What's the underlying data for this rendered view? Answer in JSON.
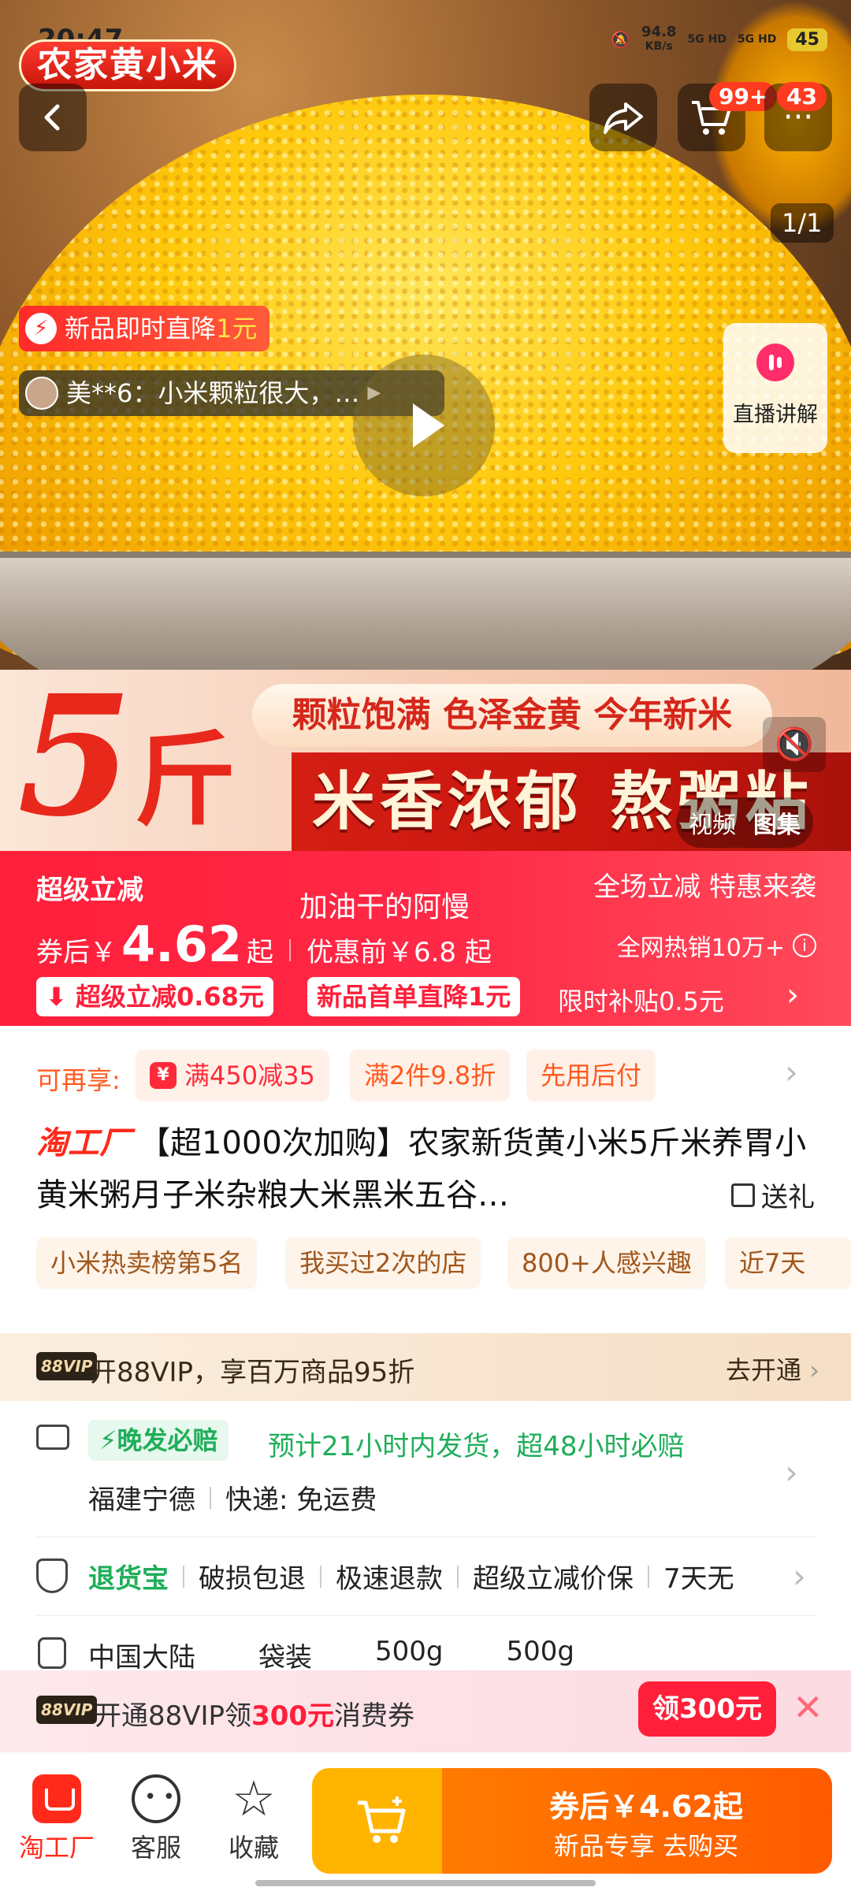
{
  "status_bar": {
    "time": "20:47",
    "speed": "94.8",
    "speed_unit": "KB/s",
    "net1": "5G HD",
    "net2": "5G HD",
    "battery": "45"
  },
  "hero": {
    "title_badge": "农家黄小米",
    "cart_badge": "99+",
    "more_badge": "43",
    "image_counter": "1/1",
    "new_price_tag": {
      "text": "新品即时直降",
      "highlight": "1元"
    },
    "review_ticker": "美**6：小米颗粒很大，…",
    "live_label": "直播讲解",
    "banner": {
      "big": "5",
      "unit": "斤",
      "line1": "颗粒饱满 色泽金黄 今年新米",
      "line2": "米香浓郁 熬粥粘稠"
    },
    "media_tabs": [
      "视频",
      "图集"
    ]
  },
  "price": {
    "super_label": "超级立减",
    "overlay_text": "加油干的阿慢",
    "prefix": "券后￥",
    "amount": "4.62",
    "suffix": "起",
    "original": "优惠前￥6.8 起",
    "promo_right1": "全场立减 特惠来袭",
    "promo_right2": "全网热销10万+",
    "chip1": "超级立减0.68元",
    "chip2": "新品首单直降1元",
    "subsidy": "限时补贴0.5元"
  },
  "coupons": {
    "label": "可再享:",
    "tags": [
      "满450减35",
      "满2件9.8折",
      "先用后付"
    ]
  },
  "product": {
    "brand": "淘工厂",
    "title": "【超1000次加购】农家新货黄小米5斤米养胃小黄米粥月子米杂粮大米黑米五谷…",
    "gift": "送礼",
    "rank_tags": [
      "小米热卖榜第5名",
      "我买过2次的店",
      "800+人感兴趣",
      "近7天"
    ]
  },
  "vip": {
    "badge": "88VIP",
    "text": "开88VIP，享百万商品95折",
    "action": "去开通"
  },
  "delivery": {
    "badge": "晚发必赔",
    "text": "预计21小时内发货，超48小时必赔",
    "origin": "福建宁德",
    "express": "快递: 免运费"
  },
  "guarantee": {
    "name": "退货宝",
    "items": [
      "破损包退",
      "极速退款",
      "超级立减价保",
      "7天无"
    ]
  },
  "specs": [
    "中国大陆",
    "袋装",
    "500g",
    "500g"
  ],
  "vip_coupon": {
    "badge": "88VIP",
    "pre": "开通88VIP领",
    "amount": "300元",
    "post": "消费券",
    "button": "领300元",
    "close": "✕"
  },
  "bottom": {
    "nav": [
      "淘工厂",
      "客服",
      "收藏"
    ],
    "buy_price": "券后￥4.62起",
    "buy_sub": "新品专享 去购买"
  },
  "colors": {
    "accent": "#ff1f3a",
    "brand": "#ff2a1a",
    "green": "#1fae5a",
    "buy_orange": "#ff5a00"
  }
}
